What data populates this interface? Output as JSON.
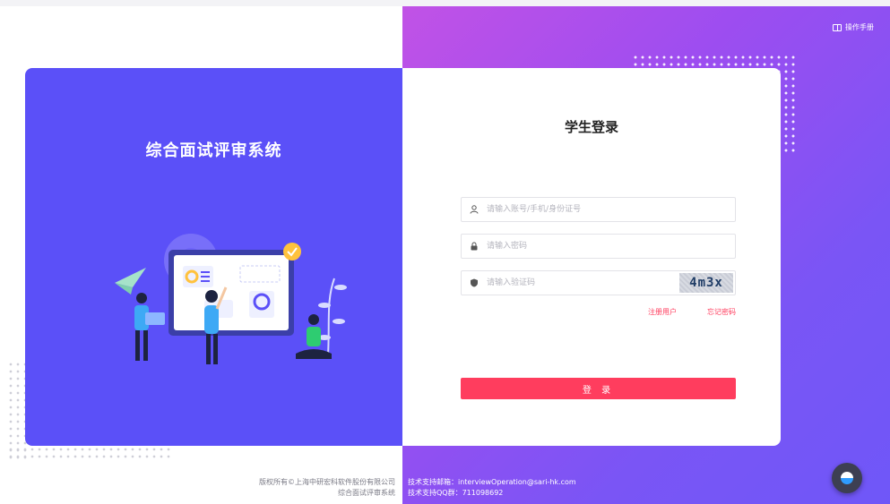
{
  "header": {
    "manual_label": "操作手册"
  },
  "left_panel": {
    "system_title": "综合面试评审系统"
  },
  "login": {
    "title": "学生登录",
    "account_placeholder": "请输入账号/手机/身份证号",
    "password_placeholder": "请输入密码",
    "captcha_placeholder": "请输入验证码",
    "captcha_text": "4m3x",
    "register_link": "注册用户",
    "forgot_link": "忘记密码",
    "submit_label": "登 录"
  },
  "footer": {
    "copyright": "版权所有©上海中研宏科软件股份有限公司",
    "system_name": "综合面试评审系统",
    "support_email": "技术支持邮箱：interviewOperation@sari-hk.com",
    "support_qq": "技术支持QQ群：711098692"
  },
  "colors": {
    "left_panel": "#5b50f8",
    "gradient_start": "#c152e6",
    "gradient_end": "#6f57f8",
    "accent": "#ff3d5e"
  }
}
